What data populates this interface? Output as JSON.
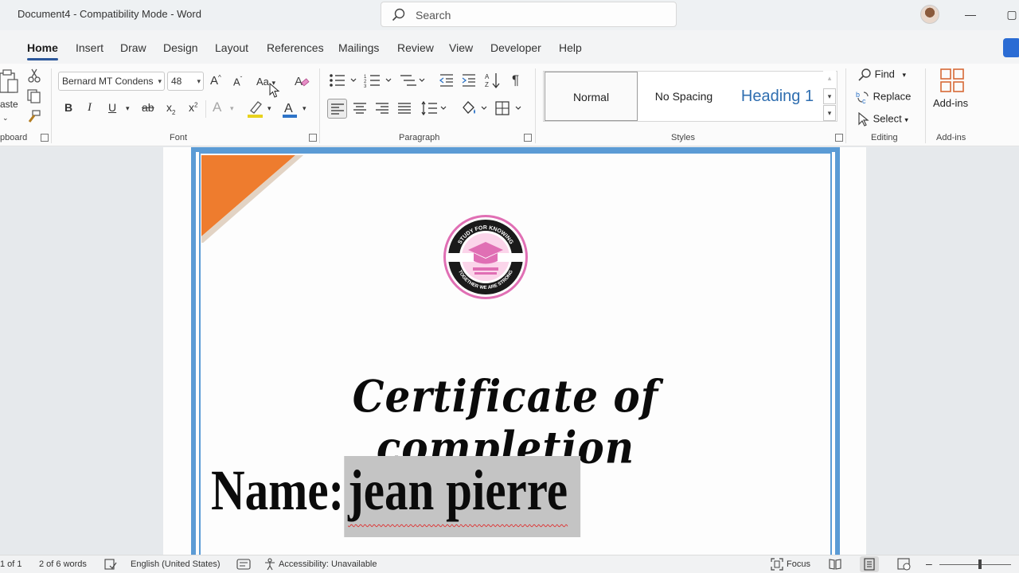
{
  "titlebar": {
    "title": "Document4  -  Compatibility Mode  -  Word",
    "search_placeholder": "Search",
    "minimize": "—",
    "restore": "▢"
  },
  "tabs": [
    "Home",
    "Insert",
    "Draw",
    "Design",
    "Layout",
    "References",
    "Mailings",
    "Review",
    "View",
    "Developer",
    "Help"
  ],
  "active_tab": "Home",
  "ribbon": {
    "clipboard": {
      "paste_label": "aste",
      "group_label": "pboard"
    },
    "font": {
      "font_name": "Bernard MT Condens",
      "font_size": "48",
      "grow": "A",
      "shrink": "A",
      "change_case": "Aa",
      "bold": "B",
      "italic": "I",
      "underline": "U",
      "strikethrough": "ab",
      "subscript": "x",
      "superscript": "x",
      "text_effects": "A",
      "font_color": "A",
      "group_label": "Font"
    },
    "paragraph": {
      "group_label": "Paragraph",
      "show_marks": "¶"
    },
    "styles": {
      "items": [
        "Normal",
        "No Spacing",
        "Heading 1"
      ],
      "group_label": "Styles"
    },
    "editing": {
      "find": "Find",
      "replace": "Replace",
      "select": "Select",
      "group_label": "Editing"
    },
    "addins": {
      "button_label": "Add-ins",
      "group_label": "Add-ins"
    }
  },
  "document": {
    "logo_top_text": "STUDY FOR KNOWING",
    "logo_bottom_text": "TOGETHER WE ARE STRONG",
    "title": "Certificate of completion",
    "name_label": "Name: ",
    "name_value": "jean pierre"
  },
  "statusbar": {
    "page": "1 of 1",
    "words": "2 of 6 words",
    "language": "English (United States)",
    "accessibility": "Accessibility: Unavailable",
    "focus": "Focus"
  },
  "colors": {
    "accent": "#2b579a",
    "frame_blue": "#5b9bd5",
    "corner_orange": "#ee7c2e",
    "logo_pink": "#e06fb4",
    "highlight_gray": "#c4c4c4",
    "font_color_red": "#d03030",
    "highlight_yellow": "#e8d21d"
  }
}
